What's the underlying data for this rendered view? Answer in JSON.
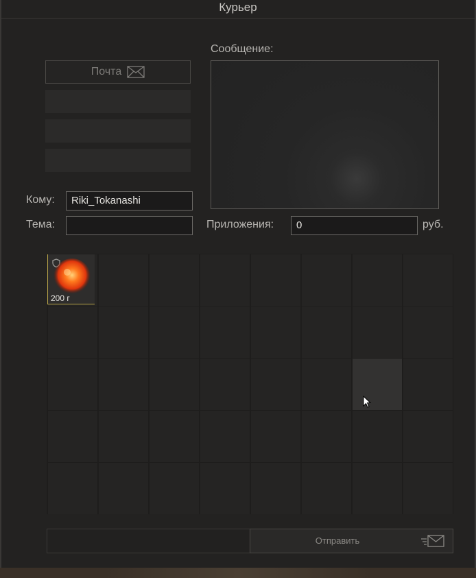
{
  "window": {
    "title": "Курьер"
  },
  "mail": {
    "button_label": "Почта"
  },
  "form": {
    "to_label": "Кому:",
    "to_value": "Riki_Tokanashi",
    "subject_label": "Тема:",
    "subject_value": "",
    "message_label": "Сообщение:",
    "attachments_label": "Приложения:",
    "attachments_value": "0",
    "currency": "руб."
  },
  "inventory": {
    "items": [
      {
        "name": "orange-orb-item",
        "amount": "200 г"
      }
    ]
  },
  "actions": {
    "send_label": "Отправить"
  },
  "colors": {
    "accent": "#b9a64a",
    "panel": "#232221"
  }
}
